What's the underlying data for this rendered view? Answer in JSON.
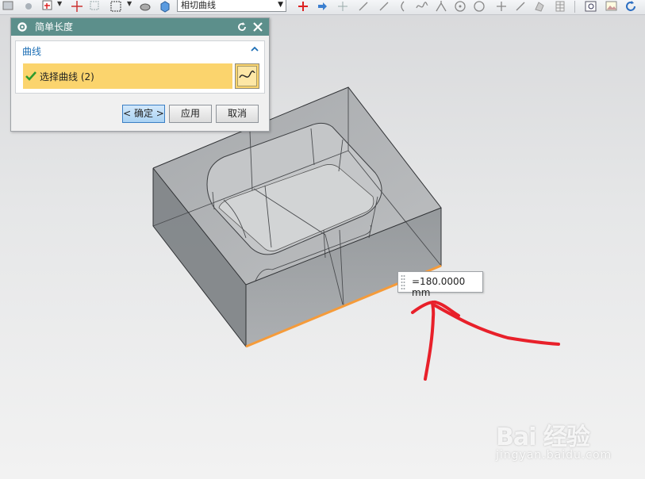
{
  "toolbar": {
    "curve_rule_value": "相切曲线",
    "icons": [
      "view-icon",
      "snap-icon",
      "select-icon",
      "move-icon",
      "box-select-icon",
      "shaded-icon",
      "cube-icon",
      "filter-icon",
      "arrow-icon",
      "point-icon",
      "line-icon",
      "tangent-icon",
      "spline-icon",
      "intersect-icon",
      "circle-icon",
      "arc-icon",
      "plus-icon",
      "slash-icon",
      "shape-icon",
      "grid-icon",
      "zoom-icon",
      "image-icon",
      "rotate-icon"
    ]
  },
  "dialog": {
    "title": "简单长度",
    "group_label": "曲线",
    "selection_label": "选择曲线 (2)",
    "ok_label": "< 确定 >",
    "apply_label": "应用",
    "cancel_label": "取消"
  },
  "measurement": {
    "value": "=180.0000 mm"
  },
  "watermark": {
    "logo": "Bai  经验",
    "url": "jingyan.baidu.com"
  },
  "colors": {
    "dialog_title": "#5c8f8b",
    "selection_highlight": "#fbd46d",
    "measured_edge": "#f59b3a",
    "annotation": "#e8202a"
  }
}
